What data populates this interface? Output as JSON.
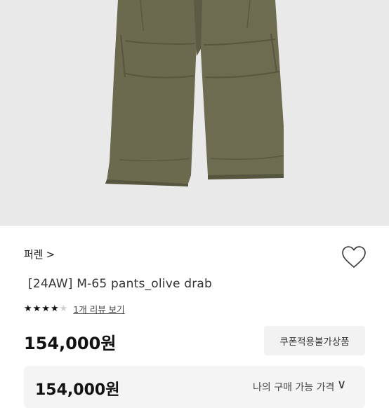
{
  "product": {
    "brand": "퍼렌",
    "brand_chevron": ">",
    "title": "[24AW] M-65 pants_olive drab",
    "rating": {
      "filled_stars": 4,
      "total_stars": 5
    },
    "review_link": "1개 리뷰 보기",
    "price": "154,000원",
    "coupon_button": "쿠폰적용불가상품"
  },
  "purchase_panel": {
    "price": "154,000원",
    "label": "나의 구매 가능 가격",
    "chevron": "∨"
  },
  "colors": {
    "pants": "#6b6a4f",
    "image_bg": "#e9e9e9"
  },
  "icons": {
    "wishlist": "heart-icon",
    "expand": "chevron-down-icon"
  }
}
